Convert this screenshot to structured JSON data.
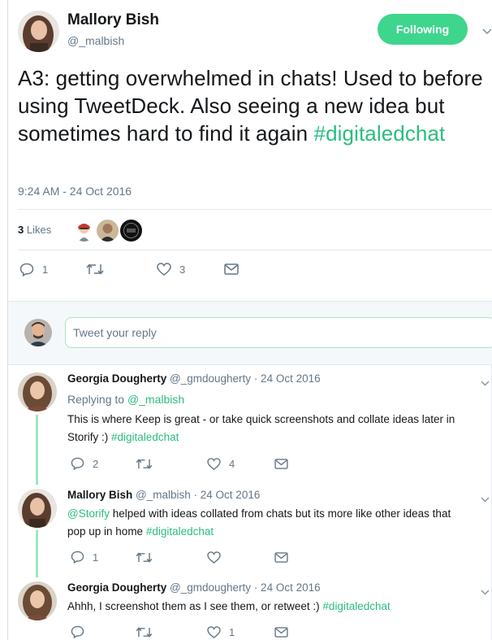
{
  "tweet": {
    "author_name": "Mallory Bish",
    "author_handle": "@_malbish",
    "follow_label": "Following",
    "text": "A3: getting overwhelmed in chats! Used to before using TweetDeck. Also seeing a new idea but sometimes hard to find it again",
    "hashtag": "#digitaledchat",
    "timestamp": "9:24 AM - 24 Oct 2016",
    "likes_count": "3",
    "likes_label": "Likes",
    "reply_count": "1",
    "retweet_count": "",
    "like_count": "3"
  },
  "reply_box": {
    "placeholder": "Tweet your reply"
  },
  "replies": [
    {
      "name": "Georgia Dougherty",
      "handle": "@_gmdougherty",
      "date": "· 24 Oct 2016",
      "replying_prefix": "Replying to",
      "replying_handle": "@_malbish",
      "text_line1": "This is where Keep is great - or take quick screenshots and collate ideas later in",
      "text_line2": "Storify :)",
      "hashtag": "#digitaledchat",
      "reply_count": "2",
      "retweet_count": "",
      "like_count": "4"
    },
    {
      "name": "Mallory Bish",
      "handle": "@_malbish",
      "date": "· 24 Oct 2016",
      "mention": "@Storify",
      "text_line1": "helped with ideas collated from chats but its more like other ideas that",
      "text_line2": "pop up in home",
      "hashtag": "#digitaledchat",
      "reply_count": "1",
      "retweet_count": "",
      "like_count": ""
    },
    {
      "name": "Georgia Dougherty",
      "handle": "@_gmdougherty",
      "date": "· 24 Oct 2016",
      "text_line1": "Ahhh, I screenshot them as I see them, or retweet :)",
      "hashtag": "#digitaledchat",
      "reply_count": "",
      "retweet_count": "",
      "like_count": "1"
    }
  ],
  "colors": {
    "accent": "#2bbd7e",
    "follow_button": "#3dd68c",
    "thread_line": "#9ee6c3",
    "muted": "#657786"
  }
}
